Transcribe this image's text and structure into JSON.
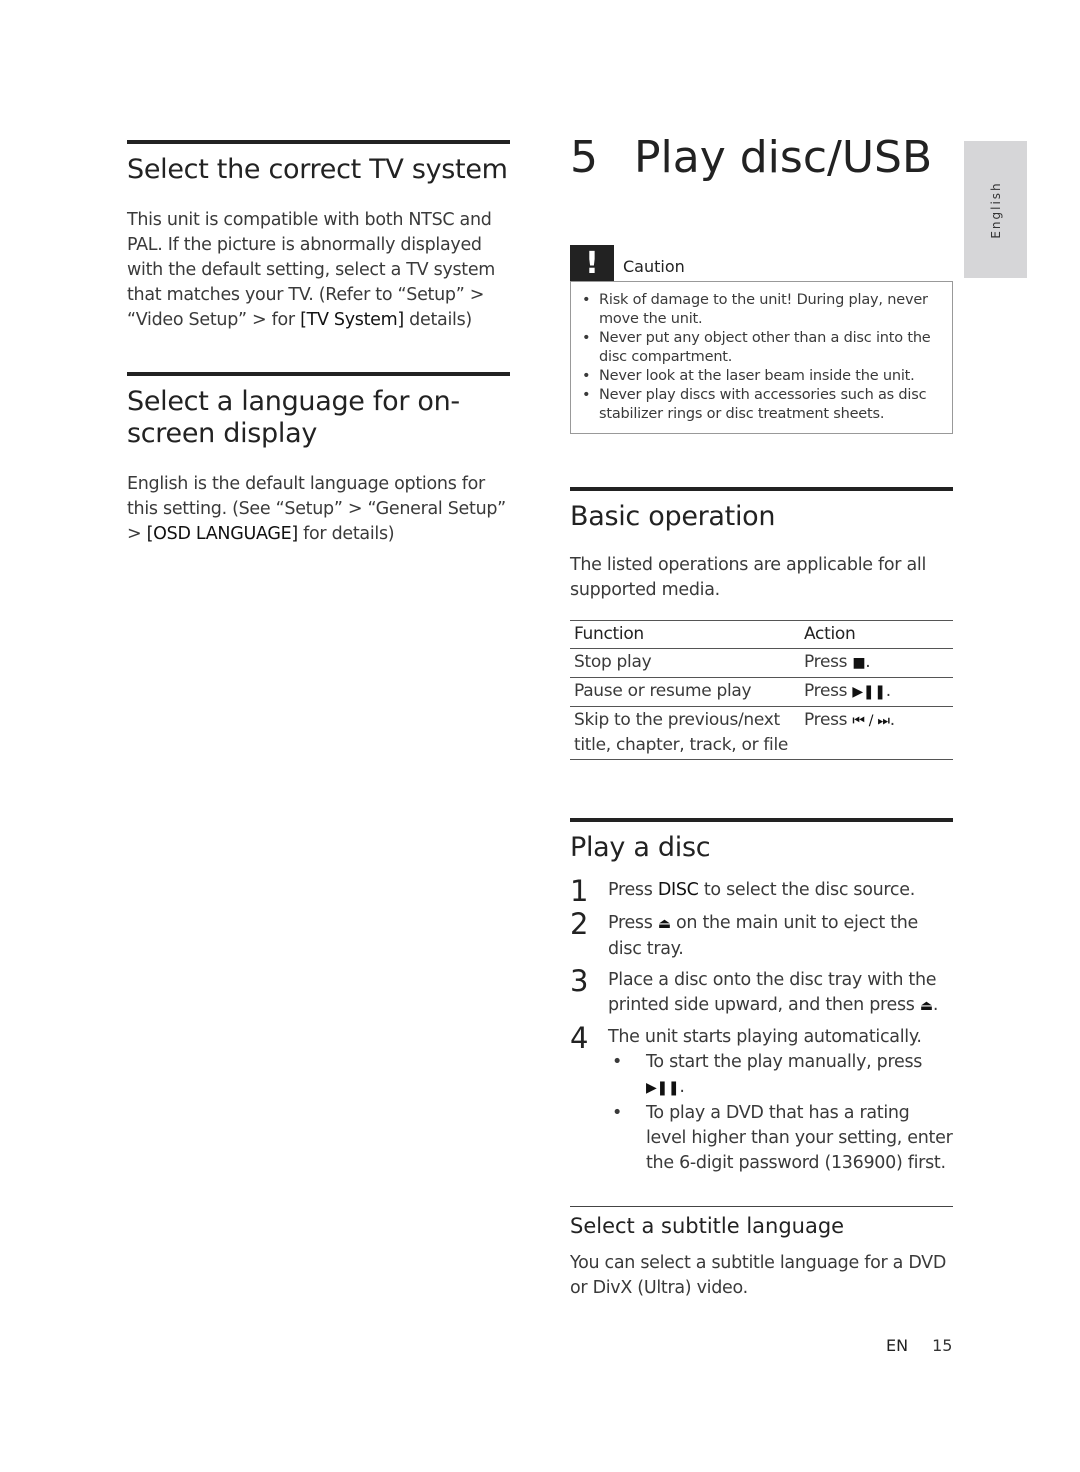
{
  "left": {
    "tv_system": {
      "heading": "Select the correct TV system",
      "body_pre": "This unit is compatible with both NTSC and PAL. If the picture is abnormally displayed with the default setting, select a TV system that matches your TV. (Refer to “Setup” > “Video Setup” > for ",
      "body_strong": "[TV System]",
      "body_post": " details)"
    },
    "osd_language": {
      "heading": "Select a language for on-screen display",
      "body_pre": "English is the default language options for this setting. (See “Setup” > “General Setup” > ",
      "body_strong": "[OSD LANGUAGE]",
      "body_post": " for details)"
    }
  },
  "chapter": {
    "number": "5",
    "title": "Play disc/USB"
  },
  "caution": {
    "icon": "exclamation-icon",
    "icon_glyph": "!",
    "label": "Caution",
    "items": [
      "Risk of damage to the unit! During play, never move the unit.",
      "Never put any object other than a disc into the disc compartment.",
      "Never look at the laser beam inside the unit.",
      "Never play discs with accessories such as disc stabilizer rings or disc treatment sheets."
    ]
  },
  "basic_operation": {
    "heading": "Basic operation",
    "intro": "The listed operations are applicable for all supported media.",
    "table": {
      "headers": [
        "Function",
        "Action"
      ],
      "rows": [
        {
          "function": "Stop play",
          "action_prefix": "Press ",
          "symbol": "■",
          "symbol_name": "stop-icon",
          "action_suffix": "."
        },
        {
          "function": "Pause or resume play",
          "action_prefix": "Press ",
          "symbol": "▶❚❚",
          "symbol_name": "play-pause-icon",
          "action_suffix": "."
        },
        {
          "function": "Skip to the previous/next title, chapter, track, or file",
          "action_prefix": "Press ",
          "symbol": "⏮ / ⏭",
          "symbol_name": "skip-prev-next-icon",
          "action_suffix": "."
        }
      ]
    }
  },
  "play_disc": {
    "heading": "Play a disc",
    "steps": [
      {
        "num": "1",
        "pre": "Press ",
        "strong": "DISC",
        "post": " to select the disc source."
      },
      {
        "num": "2",
        "pre": "Press ",
        "symbol": "⏏",
        "post": " on the main unit to eject the disc tray."
      },
      {
        "num": "3",
        "pre": "Place a disc onto the disc tray with the printed side upward, and then press ",
        "symbol": "⏏",
        "post": "."
      },
      {
        "num": "4",
        "text": "The unit starts playing automatically.",
        "bullets": [
          {
            "pre": "To start the play manually, press ",
            "symbol": "▶❚❚",
            "post": "."
          },
          {
            "text": "To play a DVD that has a rating level higher than your setting, enter the 6-digit password (136900) first."
          }
        ]
      }
    ],
    "bullet_glyph": "•"
  },
  "subtitle": {
    "heading": "Select a subtitle language",
    "body": "You can select a subtitle language for a DVD or DivX (Ultra) video."
  },
  "side_tab": {
    "label": "English"
  },
  "footer": {
    "lang": "EN",
    "page": "15"
  }
}
